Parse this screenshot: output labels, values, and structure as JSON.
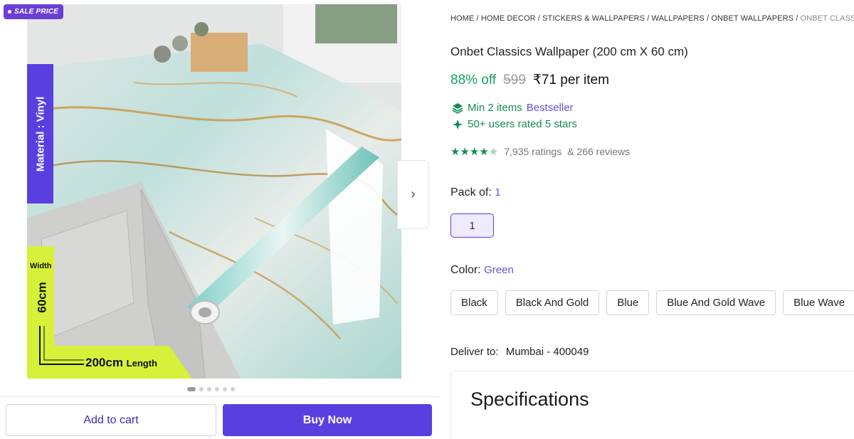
{
  "gallery": {
    "sale_badge": "SALE PRICE",
    "material_label": "Material : Vinyl",
    "dimension_width_label": "Width",
    "dimension_width_value": "60cm",
    "dimension_length_value": "200cm",
    "dimension_length_label": "Length",
    "next_arrow": "›",
    "image_count": 6,
    "active_image_index": 0
  },
  "actions": {
    "add_to_cart": "Add to cart",
    "buy_now": "Buy Now"
  },
  "breadcrumb": {
    "items": [
      "HOME",
      "HOME DECOR",
      "STICKERS & WALLPAPERS",
      "WALLPAPERS",
      "ONBET WALLPAPERS"
    ],
    "separator": " / ",
    "current": "ONBET CLASSICS"
  },
  "product": {
    "title": "Onbet Classics Wallpaper (200 cm X 60 cm)",
    "discount": "88% off",
    "mrp": "599",
    "price": "₹71 per item",
    "min_items": "Min 2 items",
    "bestseller": "Bestseller",
    "users_rated": "50+ users rated 5 stars",
    "rating_stars": 4.5,
    "ratings_count": "7,935 ratings",
    "reviews_count": "& 266 reviews"
  },
  "pack": {
    "label": "Pack of:",
    "selected_value": "1",
    "options": [
      "1"
    ]
  },
  "color": {
    "label": "Color:",
    "selected_value": "Green",
    "options": [
      "Black",
      "Black And Gold",
      "Blue",
      "Blue And Gold Wave",
      "Blue Wave"
    ]
  },
  "delivery": {
    "label": "Deliver to:",
    "location": "Mumbai - 400049"
  },
  "specifications": {
    "title": "Specifications"
  },
  "colors": {
    "primary_purple": "#5a3fe0",
    "badge_purple": "#6b3fd6",
    "success_green": "#19a063",
    "dimension_yellow": "#d7f03a"
  }
}
